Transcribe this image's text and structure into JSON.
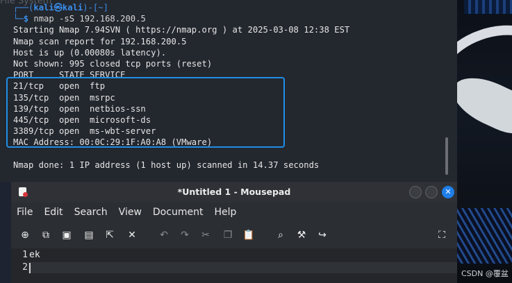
{
  "desktop": {
    "file_system_label": "File System",
    "watermark": "CSDN @覆盆"
  },
  "terminal": {
    "prompt_open": "┌──(",
    "prompt_user": "kali㉿kali",
    "prompt_dir": ")-[~]",
    "prompt_close": "└─",
    "prompt_dollar": "$ ",
    "command": "nmap -sS 192.168.200.5",
    "lines": [
      "Starting Nmap 7.94SVN ( https://nmap.org ) at 2025-03-08 12:38 EST",
      "Nmap scan report for 192.168.200.5",
      "Host is up (0.00080s latency).",
      "Not shown: 995 closed tcp ports (reset)",
      "PORT     STATE SERVICE",
      "21/tcp   open  ftp",
      "135/tcp  open  msrpc",
      "139/tcp  open  netbios-ssn",
      "445/tcp  open  microsoft-ds",
      "3389/tcp open  ms-wbt-server",
      "MAC Address: 00:0C:29:1F:A0:A8 (VMware)",
      "",
      "Nmap done: 1 IP address (1 host up) scanned in 14.37 seconds"
    ]
  },
  "mousepad": {
    "title": "*Untitled 1 - Mousepad",
    "close_glyph": "✕",
    "menu": [
      "File",
      "Edit",
      "Search",
      "View",
      "Document",
      "Help"
    ],
    "toolbar_icons": [
      "new-document-icon",
      "new-window-icon",
      "save-icon",
      "save-as-icon",
      "open-icon",
      "close-document-icon",
      "undo-icon",
      "redo-icon",
      "cut-icon",
      "copy-icon",
      "paste-icon",
      "find-icon",
      "find-replace-icon",
      "go-to-icon",
      "fullscreen-icon"
    ],
    "toolbar_glyphs": [
      "⊕",
      "⧉",
      "▣",
      "▤",
      "⇱",
      "✕",
      "↶",
      "↷",
      "✂",
      "❐",
      "📋",
      "⌕",
      "⚒",
      "↪",
      "⛶"
    ],
    "lines": [
      {
        "number": "1",
        "text": "ek"
      },
      {
        "number": "2",
        "text": ""
      }
    ]
  }
}
